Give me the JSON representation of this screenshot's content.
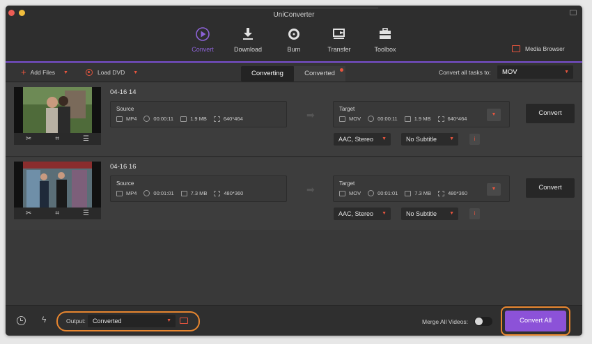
{
  "app": {
    "title": "UniConverter"
  },
  "nav": {
    "tabs": [
      {
        "label": "Convert",
        "icon": "convert-icon",
        "active": true
      },
      {
        "label": "Download",
        "icon": "download-icon"
      },
      {
        "label": "Burn",
        "icon": "burn-icon"
      },
      {
        "label": "Transfer",
        "icon": "transfer-icon"
      },
      {
        "label": "Toolbox",
        "icon": "toolbox-icon"
      }
    ],
    "media_browser": "Media Browser"
  },
  "toolbar": {
    "add_files": "Add Files",
    "load_dvd": "Load DVD",
    "segments": {
      "converting": "Converting",
      "converted": "Converted"
    },
    "convert_all_to_label": "Convert all tasks to:",
    "convert_all_to_value": "MOV"
  },
  "files": [
    {
      "name": "04-16 14",
      "source": {
        "label": "Source",
        "format": "MP4",
        "duration": "00:00:11",
        "size": "1.9 MB",
        "resolution": "640*464"
      },
      "target": {
        "label": "Target",
        "format": "MOV",
        "duration": "00:00:11",
        "size": "1.9 MB",
        "resolution": "640*464"
      },
      "audio": "AAC, Stereo",
      "subtitle": "No Subtitle",
      "convert_label": "Convert"
    },
    {
      "name": "04-16 16",
      "source": {
        "label": "Source",
        "format": "MP4",
        "duration": "00:01:01",
        "size": "7.3 MB",
        "resolution": "480*360"
      },
      "target": {
        "label": "Target",
        "format": "MOV",
        "duration": "00:01:01",
        "size": "7.3 MB",
        "resolution": "480*360"
      },
      "audio": "AAC, Stereo",
      "subtitle": "No Subtitle",
      "convert_label": "Convert"
    }
  ],
  "statusbar": {
    "output_label": "Output:",
    "output_value": "Converted",
    "merge_label": "Merge All Videos:",
    "merge_enabled": false,
    "convert_all_label": "Convert All"
  },
  "colors": {
    "accent_purple": "#8c52d8",
    "accent_orange": "#e8553e",
    "highlight_ring": "#e8862f"
  }
}
